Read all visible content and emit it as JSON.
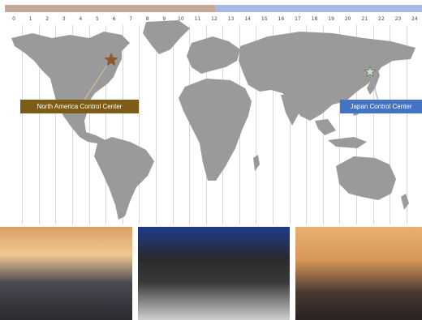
{
  "timezones": [
    "0",
    "1",
    "2",
    "3",
    "4",
    "5",
    "6",
    "7",
    "8",
    "9",
    "10",
    "11",
    "12",
    "13",
    "14",
    "15",
    "16",
    "17",
    "18",
    "19",
    "20",
    "21",
    "22",
    "23",
    "24"
  ],
  "centers": {
    "north_america": "North America Control Center",
    "japan": "Japan Control Center"
  },
  "colors": {
    "bar_left": "#c6a89a",
    "bar_right": "#a9b8e2",
    "land": "#9a9a9a",
    "na_label_bg": "#7c5c16",
    "jp_label_bg": "#4472c4",
    "na_star": "#8b5a2b",
    "jp_star": "#c8d8c8"
  },
  "icons": {
    "na_marker": "star-icon",
    "jp_marker": "star-icon"
  },
  "photos": [
    "control-room-photo",
    "operator-workstation-photo",
    "monitoring-room-photo"
  ]
}
